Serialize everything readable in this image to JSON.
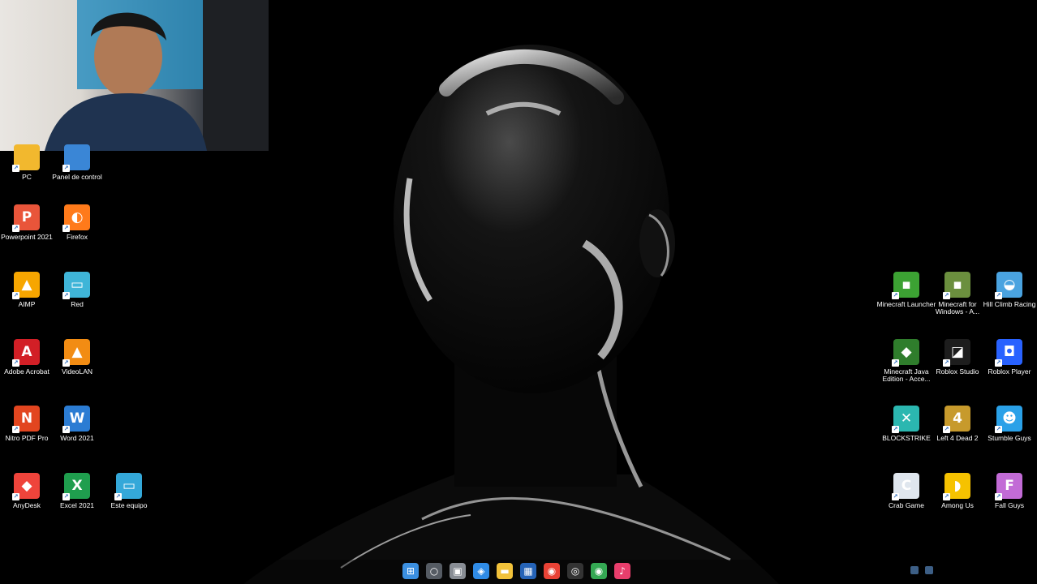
{
  "desktop": {
    "left_icons": [
      {
        "label": "PC",
        "icon": "this-pc-icon",
        "color": "#f2b82e",
        "glyph": ""
      },
      {
        "label": "Panel de control",
        "icon": "control-panel-icon",
        "color": "#3a86d6",
        "glyph": ""
      },
      {
        "label": "Powerpoint 2021",
        "icon": "powerpoint-icon",
        "color": "#e9553a",
        "glyph": "P"
      },
      {
        "label": "Firefox",
        "icon": "firefox-icon",
        "color": "#ff7a1a",
        "glyph": "◐"
      },
      {
        "label": "AIMP",
        "icon": "aimp-icon",
        "color": "#f7a600",
        "glyph": "▲"
      },
      {
        "label": "Red",
        "icon": "network-icon",
        "color": "#3fb5d8",
        "glyph": "▭"
      },
      {
        "label": "Adobe Acrobat",
        "icon": "adobe-acrobat-icon",
        "color": "#d21f26",
        "glyph": "A"
      },
      {
        "label": "VideoLAN",
        "icon": "vlc-icon",
        "color": "#f28c13",
        "glyph": "▲"
      },
      {
        "label": "Nitro PDF Pro",
        "icon": "nitro-pdf-icon",
        "color": "#e2451f",
        "glyph": "N"
      },
      {
        "label": "Word 2021",
        "icon": "word-icon",
        "color": "#2b7cd3",
        "glyph": "W"
      },
      {
        "label": "AnyDesk",
        "icon": "anydesk-icon",
        "color": "#ef443b",
        "glyph": "◆"
      },
      {
        "label": "Excel 2021",
        "icon": "excel-icon",
        "color": "#1f9e4e",
        "glyph": "X"
      },
      {
        "label": "Este equipo",
        "icon": "this-pc-monitor-icon",
        "color": "#34a8d9",
        "glyph": "▭"
      }
    ],
    "right_icons": [
      {
        "label": "Minecraft Launcher",
        "icon": "minecraft-launcher-icon",
        "color": "#3ca233",
        "glyph": "▪"
      },
      {
        "label": "Minecraft for Windows - A...",
        "icon": "minecraft-windows-icon",
        "color": "#6b8f3e",
        "glyph": "▪"
      },
      {
        "label": "Hill Climb Racing",
        "icon": "hill-climb-racing-icon",
        "color": "#4aa3e0",
        "glyph": "◒"
      },
      {
        "label": "Minecraft Java Edition - Acce...",
        "icon": "minecraft-java-icon",
        "color": "#2f7d2c",
        "glyph": "◆"
      },
      {
        "label": "Roblox Studio",
        "icon": "roblox-studio-icon",
        "color": "#1d1d1d",
        "glyph": "◪"
      },
      {
        "label": "Roblox Player",
        "icon": "roblox-player-icon",
        "color": "#2962ff",
        "glyph": "◘"
      },
      {
        "label": "BLOCKSTRIKE",
        "icon": "blockstrike-icon",
        "color": "#2bb7b0",
        "glyph": "✕"
      },
      {
        "label": "Left 4 Dead 2",
        "icon": "left4dead2-icon",
        "color": "#c79a2c",
        "glyph": "4"
      },
      {
        "label": "Stumble Guys",
        "icon": "stumble-guys-icon",
        "color": "#2aa1e8",
        "glyph": "☻"
      },
      {
        "label": "Crab Game",
        "icon": "crab-game-icon",
        "color": "#dfe6ee",
        "glyph": "C"
      },
      {
        "label": "Among Us",
        "icon": "among-us-icon",
        "color": "#f6c200",
        "glyph": "◗"
      },
      {
        "label": "Fall Guys",
        "icon": "fall-guys-icon",
        "color": "#c26bd6",
        "glyph": "F"
      }
    ]
  },
  "taskbar": {
    "items": [
      {
        "name": "start-button",
        "icon": "windows-logo-icon",
        "color": "#3b8fe0",
        "glyph": "⊞"
      },
      {
        "name": "search-button",
        "icon": "search-icon",
        "color": "#555b63",
        "glyph": "○"
      },
      {
        "name": "task-view-button",
        "icon": "task-view-icon",
        "color": "#888d94",
        "glyph": "▣"
      },
      {
        "name": "widgets-button",
        "icon": "widgets-icon",
        "color": "#2f8be6",
        "glyph": "◈"
      },
      {
        "name": "file-explorer-button",
        "icon": "folder-icon",
        "color": "#f2c23a",
        "glyph": "▬"
      },
      {
        "name": "store-button",
        "icon": "store-icon",
        "color": "#2563b7",
        "glyph": "▦"
      },
      {
        "name": "chrome-button",
        "icon": "chrome-icon",
        "color": "#e94235",
        "glyph": "◉"
      },
      {
        "name": "obs-button",
        "icon": "obs-icon",
        "color": "#333",
        "glyph": "◎"
      },
      {
        "name": "chrome-alt-button",
        "icon": "chrome-icon",
        "color": "#34a853",
        "glyph": "◉"
      },
      {
        "name": "tiktok-button",
        "icon": "tiktok-icon",
        "color": "#e83e6c",
        "glyph": "♪"
      }
    ]
  }
}
